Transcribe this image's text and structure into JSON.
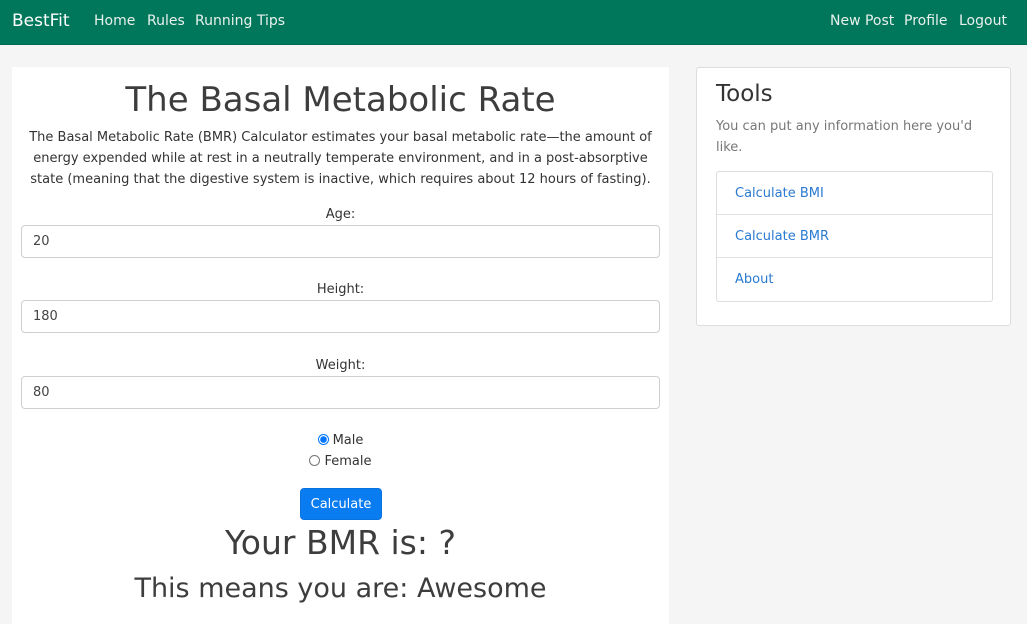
{
  "nav": {
    "brand": "BestFit",
    "left_links": [
      "Home",
      "Rules",
      "Running Tips"
    ],
    "right_links": [
      "New Post",
      "Profile",
      "Logout"
    ],
    "color": "#00775a"
  },
  "main": {
    "title": "The Basal Metabolic Rate",
    "intro": "The Basal Metabolic Rate (BMR) Calculator estimates your basal metabolic rate—the amount of energy expended while at rest in a neutrally temperate environment, and in a post-absorptive state (meaning that the digestive system is inactive, which requires about 12 hours of fasting).",
    "fields": [
      {
        "label": "Age:",
        "value": "20"
      },
      {
        "label": "Height:",
        "value": "180"
      },
      {
        "label": "Weight:",
        "value": "80"
      }
    ],
    "gender_options": [
      {
        "label": "Male",
        "checked": true
      },
      {
        "label": "Female",
        "checked": false
      }
    ],
    "calculate_label": "Calculate",
    "result_bmr": "Your BMR is: ?",
    "result_means": "This means you are: Awesome",
    "button_color": "#0a7cf2"
  },
  "sidebar": {
    "title": "Tools",
    "description": "You can put any information here you'd like.",
    "items": [
      "Calculate BMI",
      "Calculate BMR",
      "About"
    ],
    "link_color": "#2a7ad2"
  }
}
